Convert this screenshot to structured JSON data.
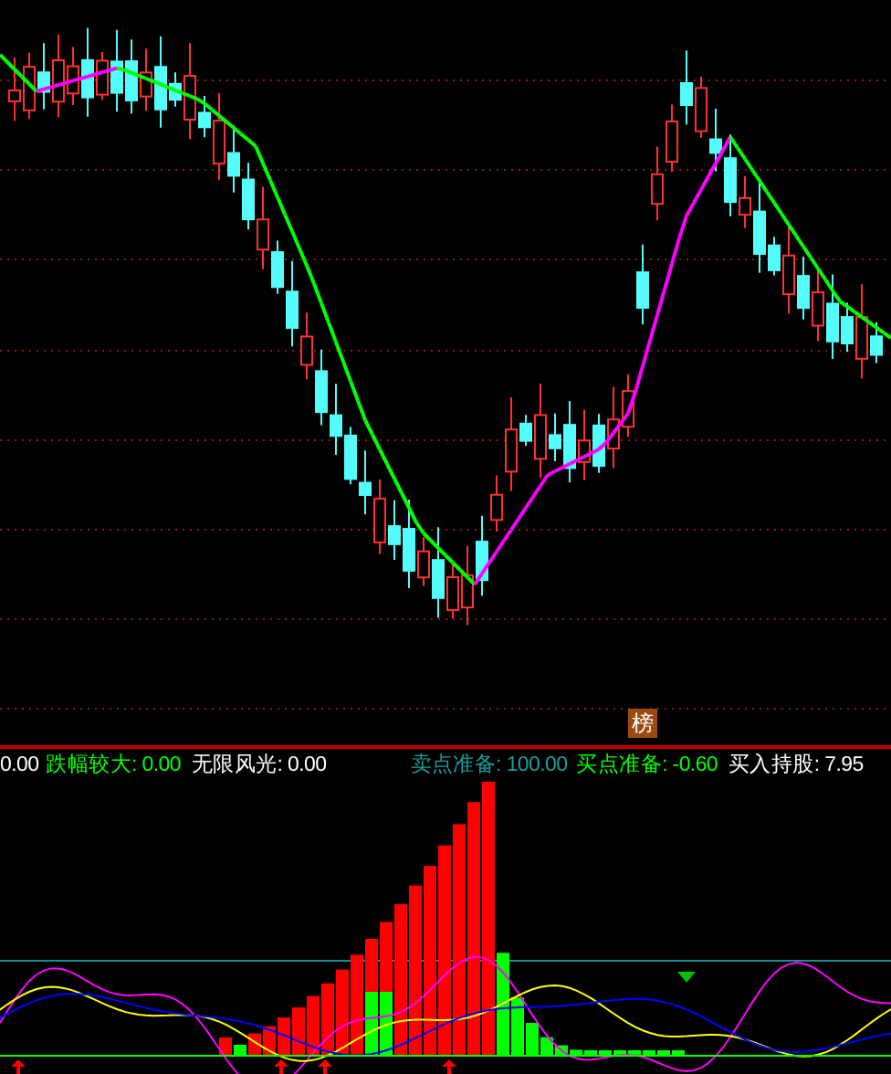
{
  "badge": {
    "text": "榜"
  },
  "indicators": [
    {
      "text": "0.00",
      "color": "#ffffff"
    },
    {
      "text": "跌幅较大: 0.00",
      "color": "#00ff00"
    },
    {
      "text": "无限风光: 0.00",
      "color": "#ffffff"
    },
    {
      "text": "卖点准备: 100.00",
      "color": "#1a9c9c"
    },
    {
      "text": "买点准备: -0.60",
      "color": "#00ff00"
    },
    {
      "text": "买入持股: 7.95",
      "color": "#ffffff"
    }
  ]
}
